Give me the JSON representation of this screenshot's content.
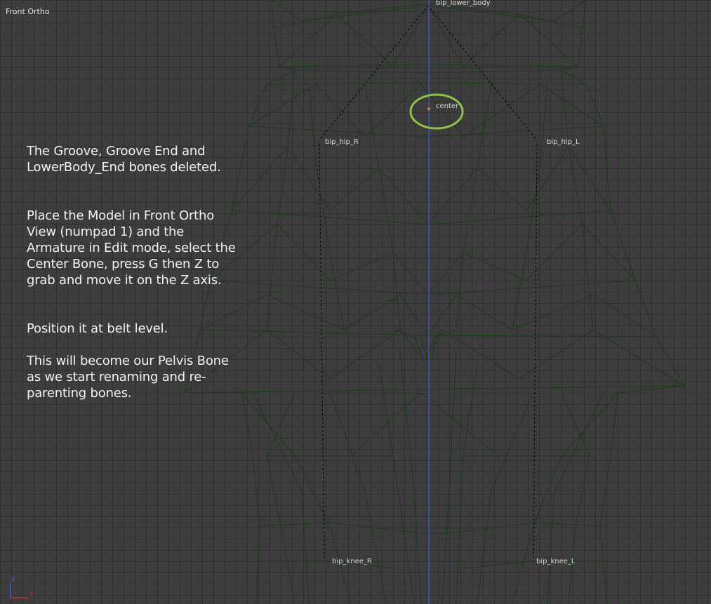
{
  "viewport": {
    "view_name": "Front Ortho"
  },
  "instructions": [
    "The Groove, Groove End and LowerBody_End bones deleted.",
    "Place the Model in Front Ortho View (numpad 1) and the Armature in Edit mode, select the Center Bone, press G then Z to grab and move it on the Z axis.",
    "Position it at belt level.",
    "This will become our Pelvis Bone as we start renaming and re-parenting bones."
  ],
  "bones": {
    "lower_body": "bip_lower_body",
    "center": "center",
    "hip_r": "bip_hip_R",
    "hip_l": "bip_hip_L",
    "knee_r": "bip_knee_R",
    "knee_l": "bip_knee_L"
  },
  "axis_gizmo": {
    "z": "Z",
    "x": "X"
  },
  "colors": {
    "mesh": "#1f3a1c",
    "highlight": "#8bc34a",
    "z_axis": "#4d5bd6"
  }
}
